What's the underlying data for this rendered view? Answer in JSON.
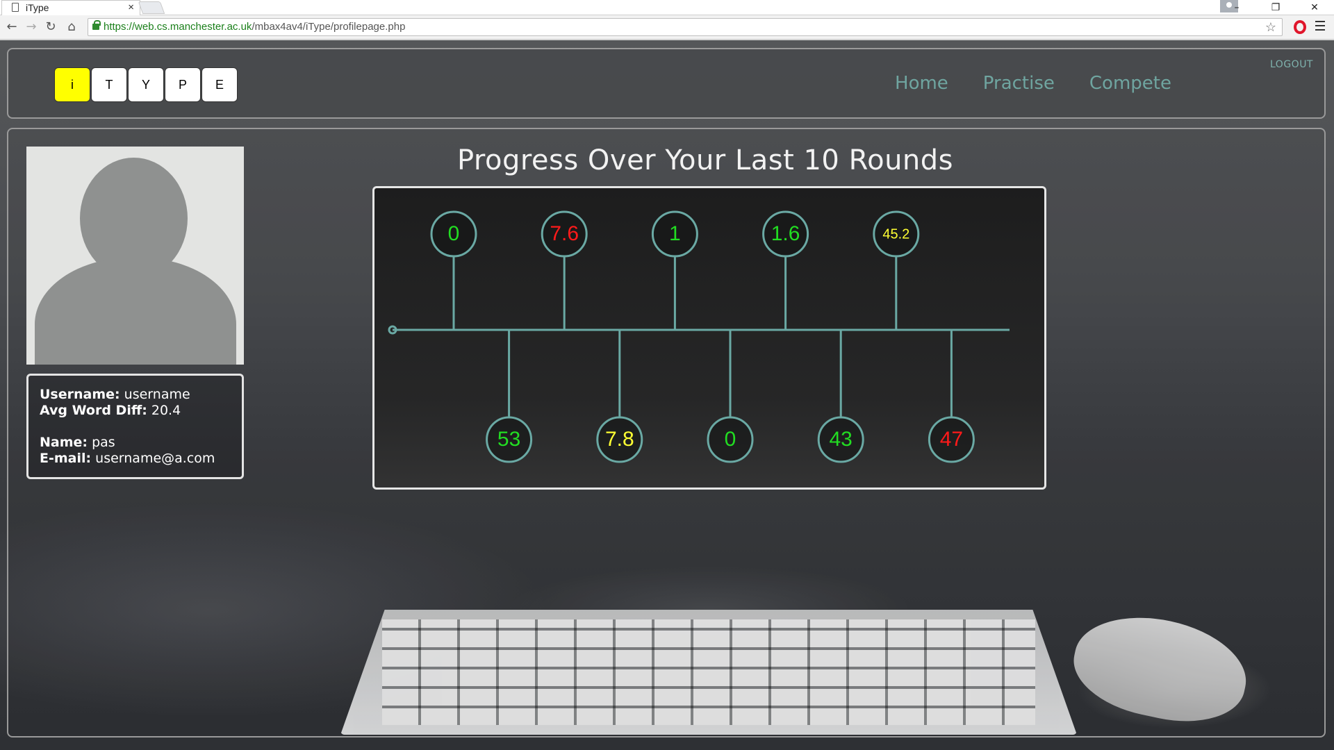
{
  "browser": {
    "tab_title": "iType",
    "tab_close": "×",
    "url_host": "https://web.cs.manchester.ac.uk",
    "url_path": "/mbax4av4/iType/profilepage.php",
    "window_controls": [
      "–",
      "❐",
      "✕"
    ]
  },
  "header": {
    "logo_letters": [
      "i",
      "T",
      "Y",
      "P",
      "E"
    ],
    "nav": [
      "Home",
      "Practise",
      "Compete"
    ],
    "logout": "LOGOUT"
  },
  "profile": {
    "username_label": "Username:",
    "username": "username",
    "avg_label": "Avg Word Diff:",
    "avg": "20.4",
    "name_label": "Name:",
    "name": "pas",
    "email_label": "E-mail:",
    "email": "username@a.com"
  },
  "chart_data": {
    "type": "timeline",
    "title": "Progress Over Your Last 10 Rounds",
    "values": [
      "0",
      "53",
      "7.6",
      "7.8",
      "1",
      "0",
      "1.6",
      "43",
      "45.2",
      "47"
    ],
    "colors": [
      "#22dd22",
      "#22dd22",
      "#ff1a1a",
      "#ffff33",
      "#22dd22",
      "#22dd22",
      "#22dd22",
      "#22dd22",
      "#ffff33",
      "#ff1a1a"
    ],
    "positions": [
      "top",
      "bottom",
      "top",
      "bottom",
      "top",
      "bottom",
      "top",
      "bottom",
      "top",
      "bottom"
    ]
  }
}
